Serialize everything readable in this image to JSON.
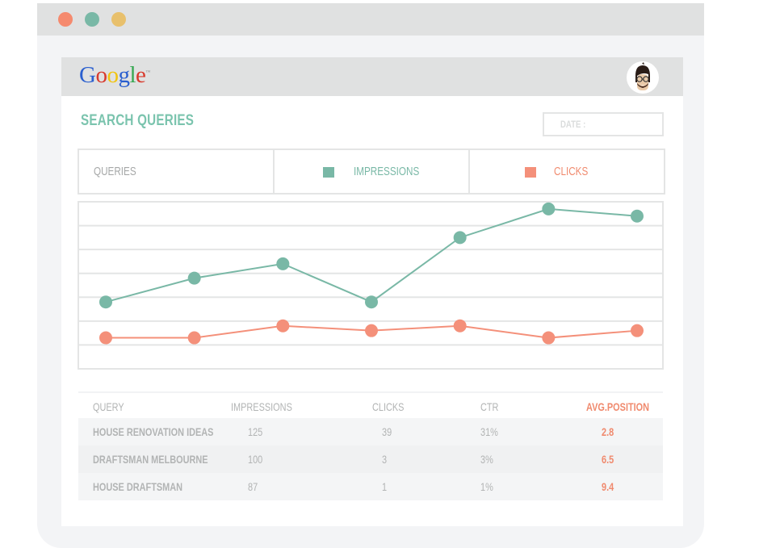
{
  "window": {
    "controls": [
      {
        "name": "close",
        "color": "#f58a6e"
      },
      {
        "name": "minimize",
        "color": "#79b8a6"
      },
      {
        "name": "maximize",
        "color": "#e8c06c"
      }
    ]
  },
  "header": {
    "logo_letters": [
      {
        "char": "G",
        "color": "#2a5fcf"
      },
      {
        "char": "o",
        "color": "#d83a2d"
      },
      {
        "char": "o",
        "color": "#f1c40f"
      },
      {
        "char": "g",
        "color": "#2a5fcf"
      },
      {
        "char": "l",
        "color": "#37a852"
      },
      {
        "char": "e",
        "color": "#d83a2d"
      }
    ],
    "logo_tm": "™",
    "avatar": "user-avatar"
  },
  "page": {
    "title": "SEARCH QUERIES",
    "date_label": "DATE :"
  },
  "legend": {
    "queries_label": "QUERIES",
    "impressions_label": "IMPRESSIONS",
    "clicks_label": "CLICKS"
  },
  "colors": {
    "impressions": "#79b8a6",
    "clicks": "#f4907a",
    "accent": "#f08a6e",
    "title": "#7bc4ae",
    "grid": "#e4e5e5"
  },
  "chart_data": {
    "type": "line",
    "title": "",
    "xlabel": "",
    "ylabel": "",
    "x": [
      1,
      2,
      3,
      4,
      5,
      6,
      7
    ],
    "ylim": [
      0,
      7
    ],
    "grid": true,
    "gridlines": 7,
    "legend_position": "top",
    "series": [
      {
        "name": "IMPRESSIONS",
        "color": "#79b8a6",
        "values": [
          2.8,
          3.8,
          4.4,
          2.8,
          5.5,
          6.7,
          6.4
        ]
      },
      {
        "name": "CLICKS",
        "color": "#f4907a",
        "values": [
          1.3,
          1.3,
          1.8,
          1.6,
          1.8,
          1.3,
          1.6
        ]
      }
    ]
  },
  "table": {
    "headers": [
      "QUERY",
      "IMPRESSIONS",
      "CLICKS",
      "CTR",
      "AVG.POSITION"
    ],
    "rows": [
      [
        "HOUSE RENOVATION IDEAS",
        "125",
        "39",
        "31%",
        "2.8"
      ],
      [
        "DRAFTSMAN MELBOURNE",
        "100",
        "3",
        "3%",
        "6.5"
      ],
      [
        "HOUSE DRAFTSMAN",
        "87",
        "1",
        "1%",
        "9.4"
      ]
    ]
  }
}
